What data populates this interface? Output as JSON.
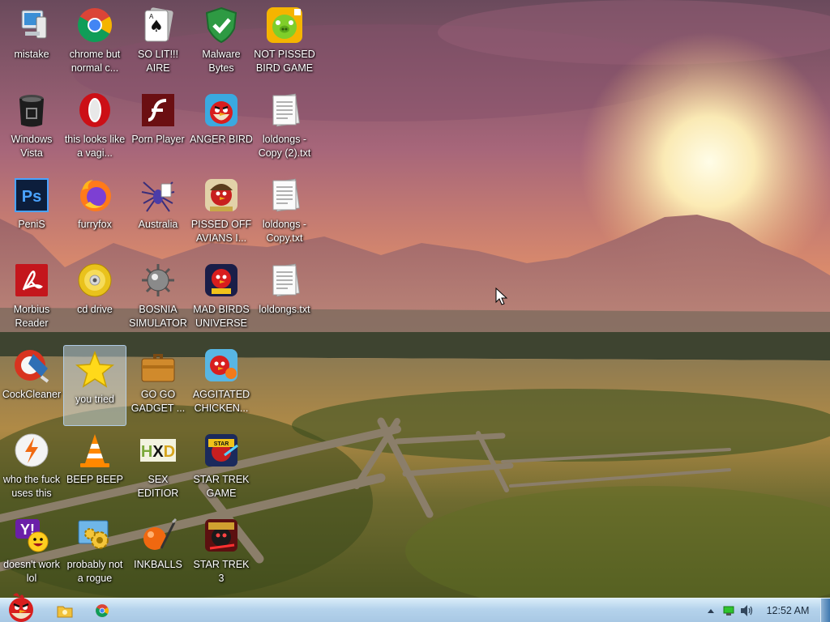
{
  "desktop": {
    "icons": [
      {
        "label": "mistake",
        "icon": "computer-icon"
      },
      {
        "label": "chrome but normal c...",
        "icon": "chrome-icon"
      },
      {
        "label": "SO LIT!!! AIRE",
        "icon": "solitaire-icon"
      },
      {
        "label": "Malware Bytes",
        "icon": "shield-icon"
      },
      {
        "label": "NOT PISSED BIRD GAME",
        "icon": "green-pig-icon"
      },
      {
        "label": "Windows Vista",
        "icon": "trash-can-icon"
      },
      {
        "label": "this looks like a vagi...",
        "icon": "opera-icon"
      },
      {
        "label": "Porn Player",
        "icon": "flash-icon"
      },
      {
        "label": "ANGER BIRD",
        "icon": "angry-bird-icon"
      },
      {
        "label": "loldongs - Copy (2).txt",
        "icon": "text-file-icon"
      },
      {
        "label": "PeniS",
        "icon": "photoshop-icon"
      },
      {
        "label": "furryfox",
        "icon": "firefox-icon"
      },
      {
        "label": "Australia",
        "icon": "spider-icon"
      },
      {
        "label": "PISSED OFF AVIANS I...",
        "icon": "angry-bird-seasons-icon"
      },
      {
        "label": "loldongs - Copy.txt",
        "icon": "text-file-icon"
      },
      {
        "label": "Morbius Reader",
        "icon": "acrobat-icon"
      },
      {
        "label": "cd drive",
        "icon": "cd-icon"
      },
      {
        "label": "BOSNIA SIMULATOR",
        "icon": "mine-icon"
      },
      {
        "label": "MAD BIRDS UNIVERSE",
        "icon": "angry-bird-space-icon"
      },
      {
        "label": "loldongs.txt",
        "icon": "text-file-icon"
      },
      {
        "label": "CockCleaner",
        "icon": "ccleaner-icon"
      },
      {
        "label": "you tried",
        "icon": "gold-star-icon"
      },
      {
        "label": "GO GO GADGET ...",
        "icon": "briefcase-icon"
      },
      {
        "label": "AGGITATED CHICKEN...",
        "icon": "angry-bird-rio-icon"
      },
      {
        "label": "who the fuck uses this",
        "icon": "winamp-icon"
      },
      {
        "label": "BEEP BEEP",
        "icon": "vlc-cone-icon"
      },
      {
        "label": "SEX EDITIOR",
        "icon": "hxd-icon"
      },
      {
        "label": "STAR TREK GAME",
        "icon": "star-wars-bird-icon"
      },
      {
        "label": "doesn't work lol",
        "icon": "yahoo-messenger-icon"
      },
      {
        "label": "probably not a rogue",
        "icon": "gear-monitor-icon"
      },
      {
        "label": "INKBALLS",
        "icon": "inkball-icon"
      },
      {
        "label": "STAR TREK 3",
        "icon": "star-wars-bird-2-icon"
      }
    ]
  },
  "taskbar": {
    "start_icon": "angry-bird-start-icon",
    "pinned": [
      {
        "name": "explorer-icon"
      },
      {
        "name": "chrome-icon"
      }
    ],
    "tray": {
      "icons": [
        "show-hidden-icons-arrow",
        "network-icon",
        "volume-icon"
      ],
      "clock": "12:52 AM"
    }
  },
  "colors": {
    "taskbar": "#b5d3ec",
    "selection": "#d2e6fa",
    "label_text": "#ffffff"
  }
}
